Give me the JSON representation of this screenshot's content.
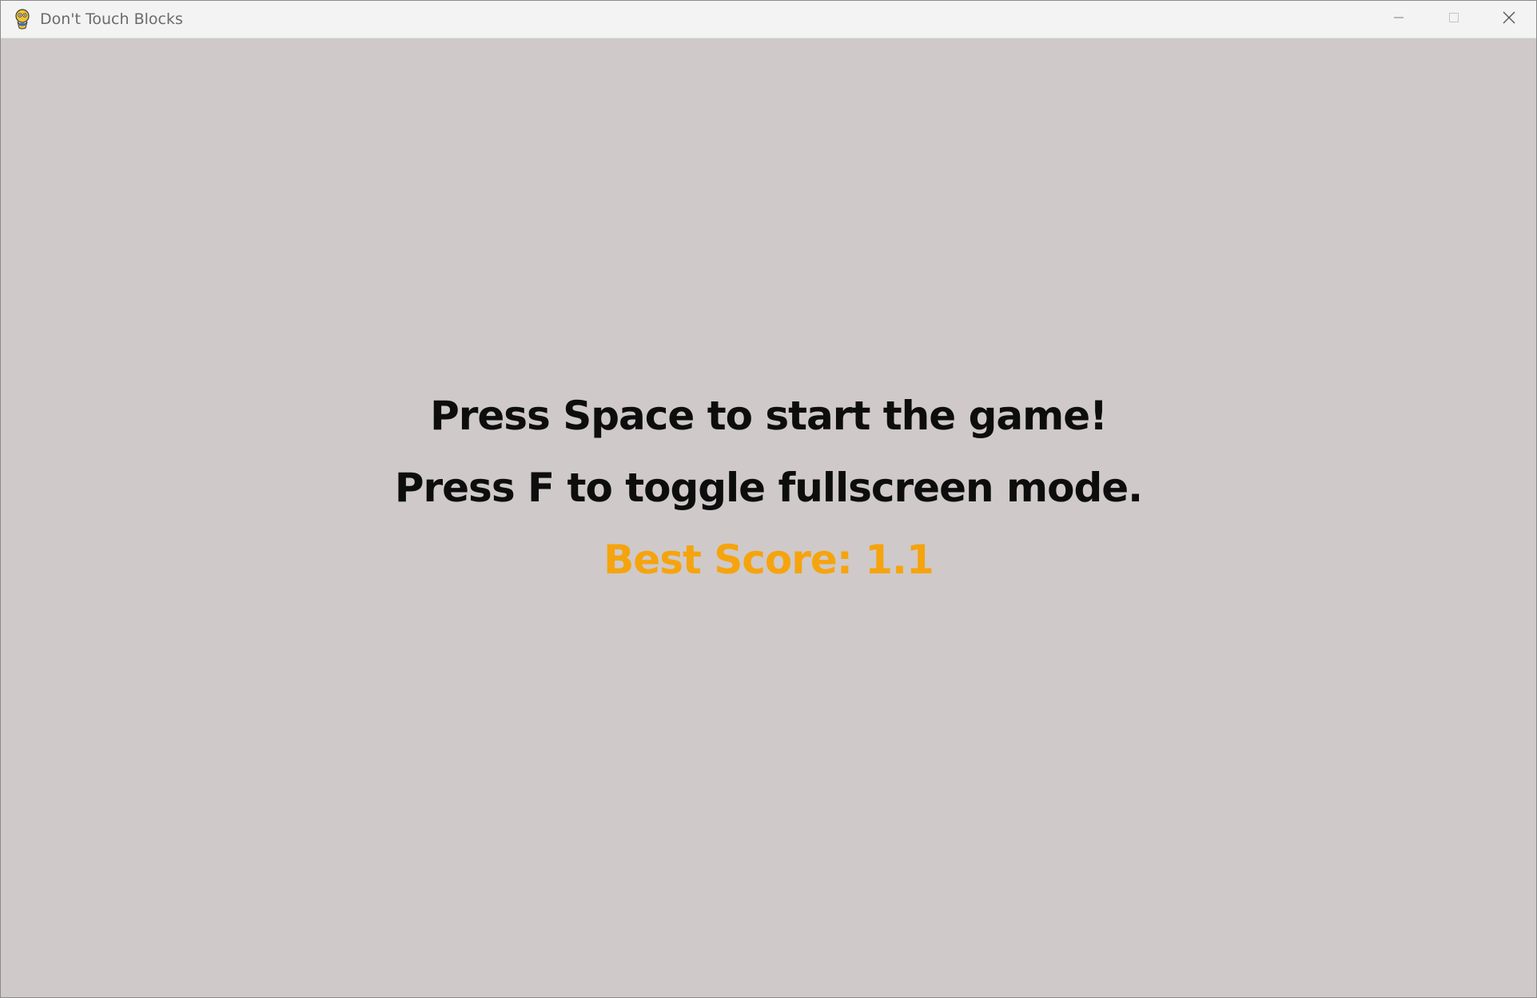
{
  "window": {
    "title": "Don't Touch Blocks",
    "icon": "pygame-snake-icon",
    "controls": {
      "minimize_icon": "minimize-icon",
      "maximize_icon": "maximize-icon",
      "close_icon": "close-icon"
    }
  },
  "game": {
    "start_prompt": "Press Space to start the game!",
    "fullscreen_prompt": "Press F to toggle fullscreen mode.",
    "best_score_label": "Best Score: 1.1",
    "colors": {
      "background": "#cfc9c9",
      "prompt_text": "#0d0d0d",
      "best_score_text": "#f5a40d"
    }
  }
}
